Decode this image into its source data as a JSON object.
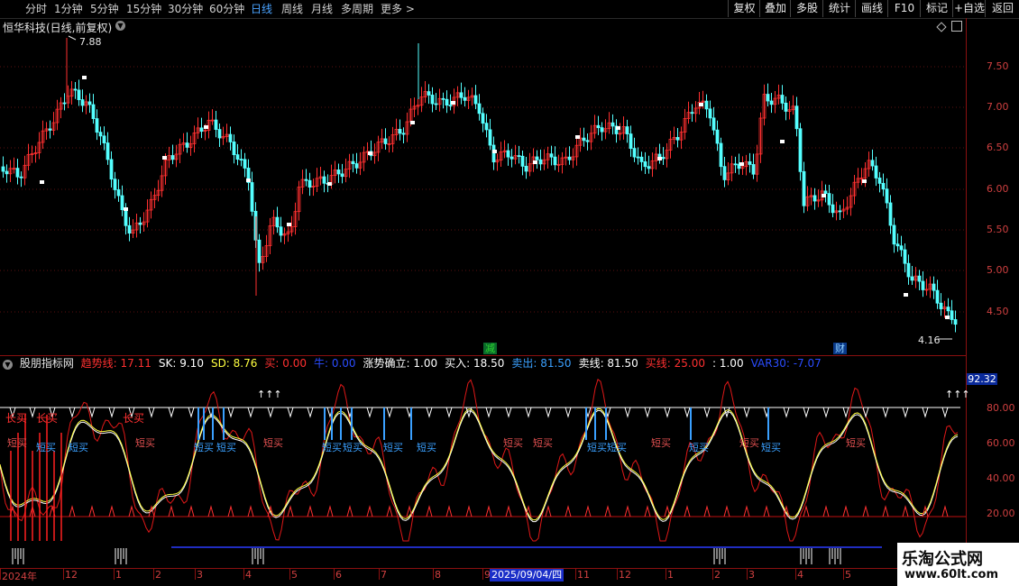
{
  "toolbar": {
    "timeframes": [
      "分时",
      "1分钟",
      "5分钟",
      "15分钟",
      "30分钟",
      "60分钟",
      "日线",
      "周线",
      "月线",
      "多周期",
      "更多 >"
    ],
    "active_timeframe": "日线",
    "right_buttons": [
      "复权",
      "叠加",
      "多股",
      "统计",
      "画线",
      "F10",
      "标记",
      "+自选",
      "返回"
    ]
  },
  "stock": {
    "title": "恒华科技(日线,前复权)",
    "high_label": "7.88",
    "low_label": "4.16",
    "price_ticks": [
      "7.50",
      "7.00",
      "6.50",
      "6.00",
      "5.50",
      "5.00",
      "4.50"
    ],
    "event_tags": [
      {
        "text": "减",
        "color": "#2fd42f"
      },
      {
        "text": "财",
        "color": "#4aa3ff"
      }
    ]
  },
  "indicator": {
    "name": "股朋指标网",
    "params": [
      {
        "label": "趋势线: ",
        "value": "17.11",
        "color": "#ff3030"
      },
      {
        "label": "SK: ",
        "value": "9.10",
        "color": "#ffffff"
      },
      {
        "label": "SD: ",
        "value": "8.76",
        "color": "#ffff40"
      },
      {
        "label": "买: ",
        "value": "0.00",
        "color": "#ff3030"
      },
      {
        "label": "牛: ",
        "value": "0.00",
        "color": "#2a4cff"
      },
      {
        "label": "涨势确立: ",
        "value": "1.00",
        "color": "#ffffff"
      },
      {
        "label": "买入: ",
        "value": "18.50",
        "color": "#ffffff"
      },
      {
        "label": "卖出: ",
        "value": "81.50",
        "color": "#3aa0ff"
      },
      {
        "label": "卖线: ",
        "value": "81.50",
        "color": "#ffffff"
      },
      {
        "label": "买线: ",
        "value": "25.00",
        "color": "#ff3030"
      },
      {
        "label": ": ",
        "value": "1.00",
        "color": "#ffffff"
      },
      {
        "label": "VAR30: ",
        "value": "-7.07",
        "color": "#2a4cff"
      }
    ],
    "current_value": "92.32",
    "y_ticks": [
      "80.00",
      "60.00",
      "40.00",
      "20.00"
    ],
    "annotations": {
      "short_buy": "短买",
      "long_buy": "长买",
      "arrows": "↑↑↑"
    }
  },
  "x_axis": {
    "labels": [
      "2024年",
      "12",
      "1",
      "2",
      "3",
      "4",
      "5",
      "6",
      "7",
      "8",
      "9",
      "11",
      "12",
      "1",
      "2",
      "3",
      "4",
      "5"
    ],
    "cursor_date": "2025/09/04/四"
  },
  "watermark": {
    "site": "乐淘公式网",
    "url": "www.60lt.com"
  }
}
